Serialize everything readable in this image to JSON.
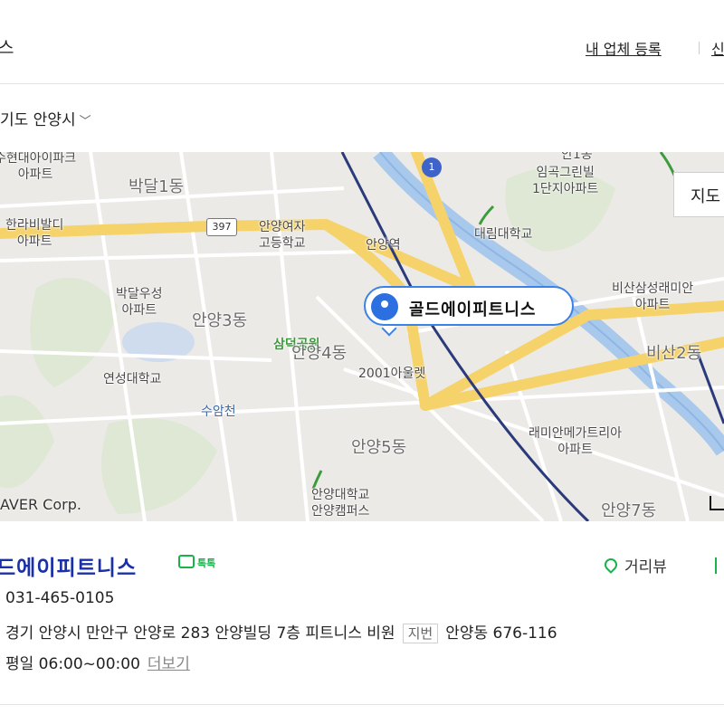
{
  "header": {
    "title_fragment": "스",
    "register_link": "내 업체 등록",
    "right_fragment": "신"
  },
  "region": {
    "label": "기도 안양시",
    "chevron": "chevron-down-icon"
  },
  "map": {
    "labels": {
      "hyundai_apt": "수현대아이파크\n아파트",
      "bakdal1": "박달1동",
      "halla_apt": "한라비발디\n아파트",
      "girls_high": "안양여자\n고등학교",
      "anyang_station": "안양역",
      "imgok_apt": "임곡그린빌\n1단지아파트",
      "daelim_univ": "대림대학교",
      "bakdal_wooseong": "박달우성\n아파트",
      "anyang3": "안양3동",
      "samdeok_park": "삼덕공원",
      "anyang4": "안양4동",
      "outlet": "2001아울렛",
      "bisan_raemian": "비산삼성래미안\n아파트",
      "bisan2": "비산2동",
      "yeonseong_univ": "연성대학교",
      "suamcheon": "수암천",
      "raemian_mega": "래미안메가트리아\n아파트",
      "anyang5": "안양5동",
      "anyang_univ": "안양대학교\n안양캠퍼스",
      "anyang7": "안양7동",
      "top_partial": "안1동"
    },
    "road_number": "397",
    "route_number": "1",
    "pin_label": "골드에이피트니스",
    "map_button": "지도",
    "copyright": "AVER Corp."
  },
  "place": {
    "name": "드에이피트니스",
    "talk_label": "톡톡",
    "street_view": "거리뷰",
    "phone": "031-465-0105",
    "address": "경기 안양시 만안구 안양로 283 안양빌딩 7층 피트니스 비원",
    "lot_tag": "지번",
    "lot_address": "안양동 676-116",
    "hours": "평일 06:00~00:00",
    "more_link": "더보기"
  },
  "colors": {
    "place_name": "#1b2fa8",
    "pin_border": "#3b82e6",
    "green": "#19b24b",
    "road": "#f5d36a",
    "river": "#a8c9ec",
    "rail": "#2b3a7a"
  }
}
